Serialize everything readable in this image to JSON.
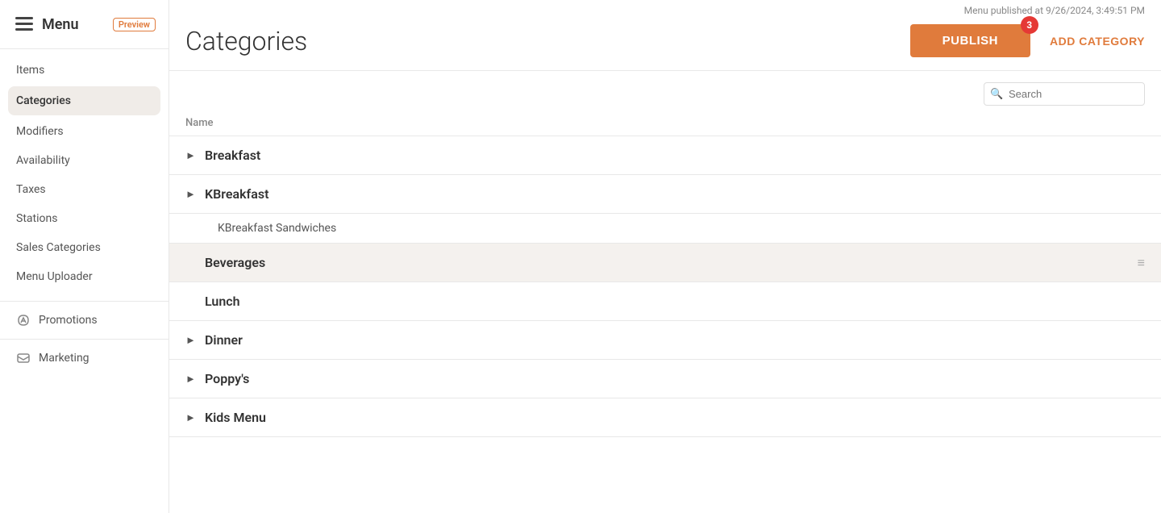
{
  "sidebar": {
    "logo_text": "Menu",
    "preview_label": "Preview",
    "menu_section_items": [
      {
        "id": "items",
        "label": "Items"
      },
      {
        "id": "categories",
        "label": "Categories",
        "active": true
      },
      {
        "id": "modifiers",
        "label": "Modifiers"
      },
      {
        "id": "availability",
        "label": "Availability"
      },
      {
        "id": "taxes",
        "label": "Taxes"
      },
      {
        "id": "stations",
        "label": "Stations"
      },
      {
        "id": "sales-categories",
        "label": "Sales Categories"
      },
      {
        "id": "menu-uploader",
        "label": "Menu Uploader"
      }
    ],
    "promotions_label": "Promotions",
    "marketing_label": "Marketing"
  },
  "top_bar": {
    "published_text": "Menu published at 9/26/2024, 3:49:51 PM"
  },
  "header": {
    "page_title": "Categories",
    "publish_button_label": "PUBLISH",
    "publish_badge_count": "3",
    "add_category_label": "ADD CATEGORY"
  },
  "search": {
    "placeholder": "Search"
  },
  "table": {
    "column_name": "Name",
    "categories": [
      {
        "id": "breakfast",
        "label": "Breakfast",
        "expanded": false,
        "sub_items": []
      },
      {
        "id": "kbreakfast",
        "label": "KBreakfast",
        "expanded": true,
        "sub_items": [
          {
            "id": "kbreakfast-sandwiches",
            "label": "KBreakfast Sandwiches"
          }
        ]
      },
      {
        "id": "beverages",
        "label": "Beverages",
        "expanded": false,
        "highlighted": true,
        "sub_items": []
      },
      {
        "id": "lunch",
        "label": "Lunch",
        "expanded": false,
        "no_chevron": true,
        "sub_items": []
      },
      {
        "id": "dinner",
        "label": "Dinner",
        "expanded": false,
        "sub_items": []
      },
      {
        "id": "poppys",
        "label": "Poppy's",
        "expanded": false,
        "sub_items": []
      },
      {
        "id": "kids-menu",
        "label": "Kids Menu",
        "expanded": false,
        "sub_items": []
      }
    ]
  }
}
